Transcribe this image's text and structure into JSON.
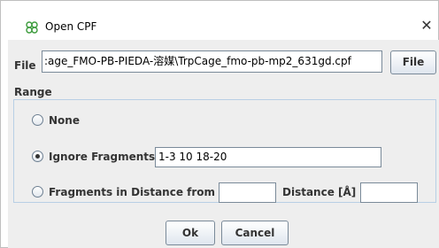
{
  "window": {
    "title": "Open CPF",
    "close_glyph": "✕",
    "icon": "cluster-link-icon",
    "icon_color": "#3a9a3a"
  },
  "file": {
    "label": "File",
    "path": ":age_FMO-PB-PIEDA-溶媒\\TrpCage_fmo-pb-mp2_631gd.cpf",
    "button_label": "File"
  },
  "range": {
    "label": "Range",
    "options": {
      "none": {
        "label": "None",
        "selected": false
      },
      "ignore": {
        "label": "Ignore Fragments",
        "selected": true,
        "value": "1-3 10 18-20"
      },
      "distance": {
        "label": "Fragments in Distance  from",
        "selected": false,
        "from_value": "",
        "distance_label": "Distance [Å]",
        "distance_value": ""
      }
    }
  },
  "buttons": {
    "ok": "Ok",
    "cancel": "Cancel"
  },
  "colors": {
    "panel_bg": "#eeeeee",
    "border": "#7a8a99",
    "group_border": "#b8cfe5"
  }
}
